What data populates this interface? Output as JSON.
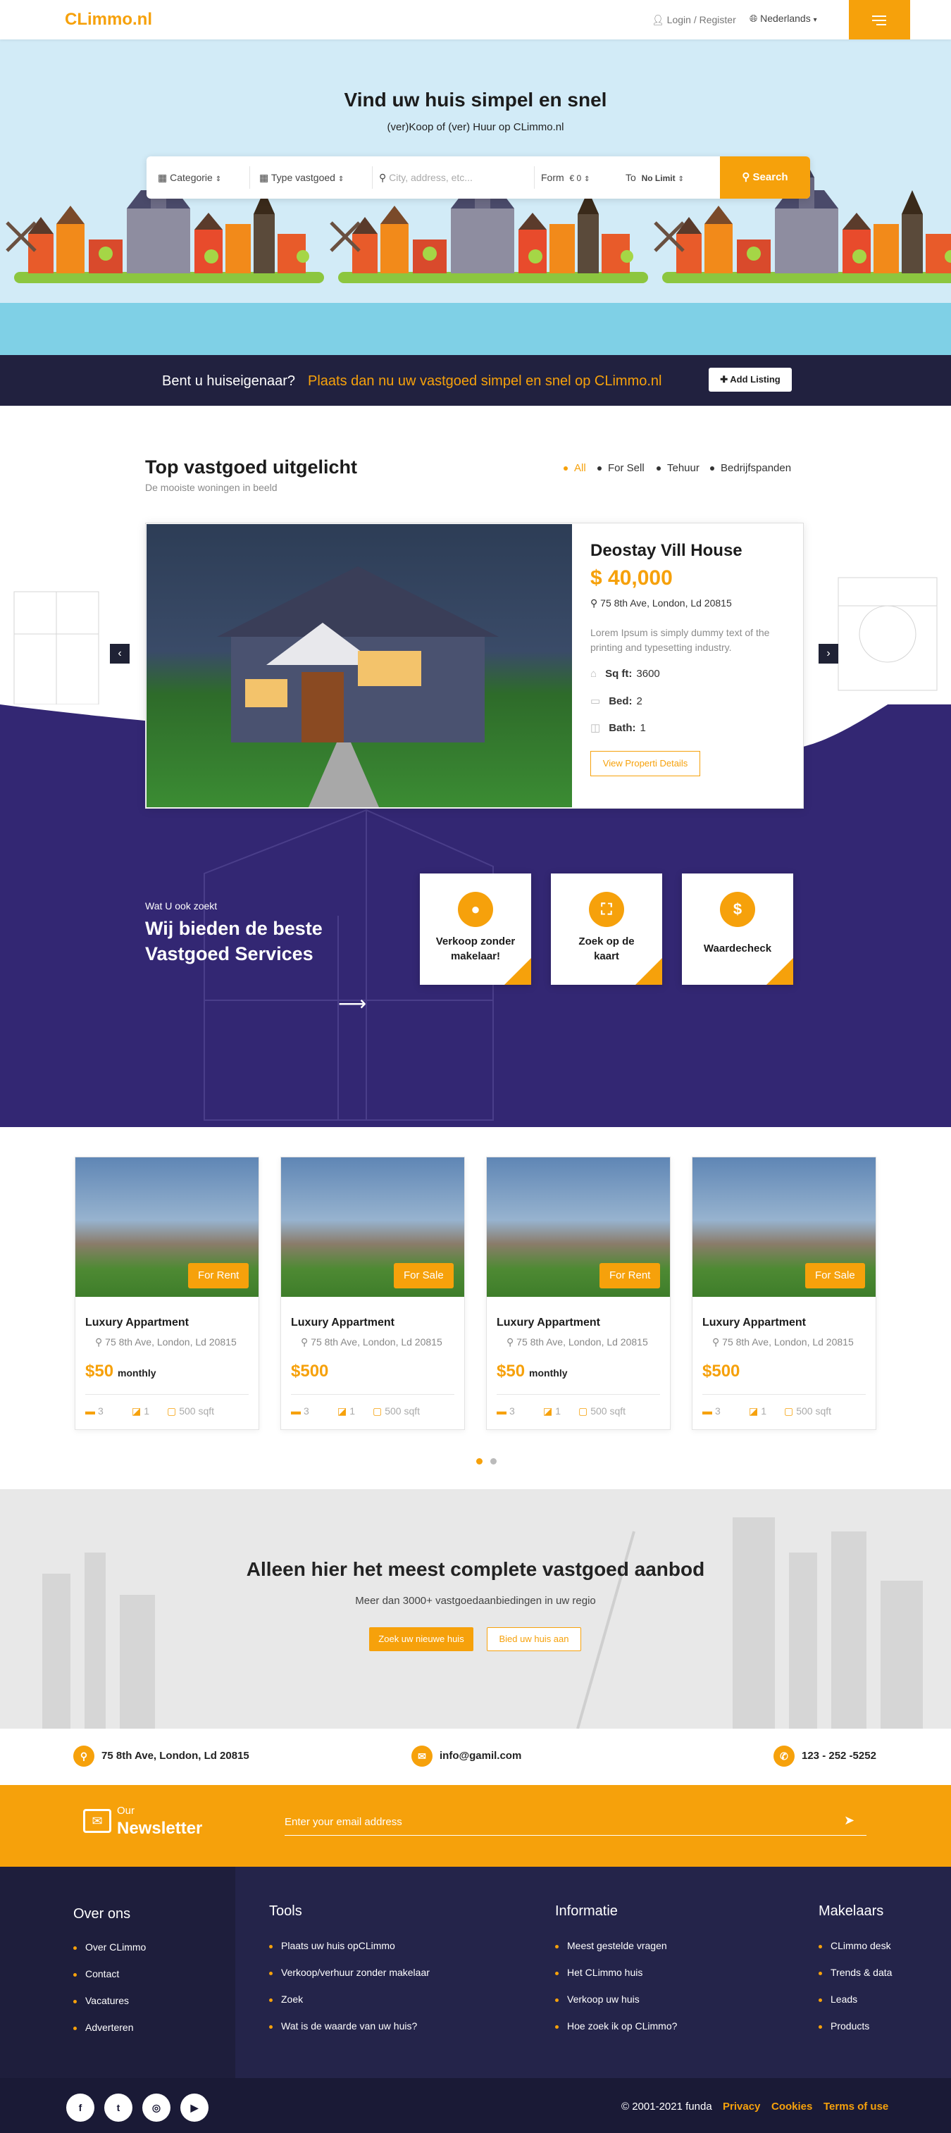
{
  "header": {
    "logo": "CLimmo.nl",
    "login": "Login / Register",
    "language": "Nederlands"
  },
  "hero": {
    "title": "Vind uw huis simpel en snel",
    "subtitle": "(ver)Koop of (ver) Huur op CLimmo.nl",
    "search": {
      "categorie": "Categorie",
      "type": "Type vastgoed",
      "location_placeholder": "City, address, etc...",
      "form_label": "Form",
      "form_value": "€ 0",
      "to_label": "To",
      "to_value": "No Limit",
      "button": "Search"
    }
  },
  "owner_banner": {
    "question": "Bent u huiseigenaar?",
    "cta": "Plaats dan nu uw vastgoed simpel en snel op CLimmo.nl",
    "button": "Add Listing"
  },
  "featured": {
    "title": "Top vastgoed uitgelicht",
    "subtitle": "De mooiste woningen in beeld",
    "filters": [
      "All",
      "For Sell",
      "Tehuur",
      "Bedrijfspanden"
    ],
    "property": {
      "name": "Deostay Vill House",
      "price": "$ 40,000",
      "address": "75 8th Ave, London, Ld 20815",
      "description": "Lorem Ipsum is simply dummy text of the printing and typesetting industry.",
      "sqft_label": "Sq ft:",
      "sqft": "3600",
      "bed_label": "Bed:",
      "bed": "2",
      "bath_label": "Bath:",
      "bath": "1",
      "button": "View Properti Details"
    }
  },
  "services": {
    "pretitle": "Wat U ook zoekt",
    "title": "Wij bieden de beste Vastgoed Services",
    "items": [
      {
        "label": "Verkoop zonder makelaar!",
        "icon": "user-icon"
      },
      {
        "label": "Zoek op de kaart",
        "icon": "map-icon"
      },
      {
        "label": "Waardecheck",
        "icon": "dollar-icon"
      }
    ]
  },
  "listings": [
    {
      "tag": "For Rent",
      "name": "Luxury Appartment",
      "address": "75 8th Ave, London, Ld 20815",
      "price": "$50",
      "period": "monthly",
      "beds": "3",
      "baths": "1",
      "area": "500 sqft"
    },
    {
      "tag": "For Sale",
      "name": "Luxury Appartment",
      "address": "75 8th Ave, London, Ld 20815",
      "price": "$500",
      "period": "",
      "beds": "3",
      "baths": "1",
      "area": "500 sqft"
    },
    {
      "tag": "For Rent",
      "name": "Luxury Appartment",
      "address": "75 8th Ave, London, Ld 20815",
      "price": "$50",
      "period": "monthly",
      "beds": "3",
      "baths": "1",
      "area": "500 sqft"
    },
    {
      "tag": "For Sale",
      "name": "Luxury Appartment",
      "address": "75 8th Ave, London, Ld 20815",
      "price": "$500",
      "period": "",
      "beds": "3",
      "baths": "1",
      "area": "500 sqft"
    }
  ],
  "cta": {
    "title": "Alleen hier het meest complete vastgoed aanbod",
    "subtitle": "Meer dan 3000+ vastgoedaanbiedingen in uw regio",
    "btn_primary": "Zoek uw nieuwe huis",
    "btn_secondary": "Bied uw huis aan"
  },
  "contact": {
    "address": "75 8th Ave, London, Ld 20815",
    "email": "info@gamil.com",
    "phone": "123 - 252 -5252"
  },
  "newsletter": {
    "our": "Our",
    "title": "Newsletter",
    "placeholder": "Enter your email address"
  },
  "footer": {
    "over": {
      "title": "Over ons",
      "links": [
        "Over CLimmo",
        "Contact",
        "Vacatures",
        "Adverteren"
      ]
    },
    "tools": {
      "title": "Tools",
      "links": [
        "Plaats uw huis opCLimmo",
        "Verkoop/verhuur zonder makelaar",
        "Zoek",
        "Wat is de waarde van uw huis?"
      ]
    },
    "info": {
      "title": "Informatie",
      "links": [
        "Meest gestelde vragen",
        "Het CLimmo huis",
        "Verkoop uw huis",
        "Hoe zoek ik op CLimmo?"
      ]
    },
    "makelaars": {
      "title": "Makelaars",
      "links": [
        "CLimmo desk",
        "Trends & data",
        "Leads",
        "Products"
      ]
    },
    "social": [
      "f",
      "t",
      "◎",
      "▶"
    ],
    "copyright": "© 2001-2021 funda",
    "privacy": "Privacy",
    "cookies": "Cookies",
    "terms": "Terms of use"
  },
  "colors": {
    "accent": "#f6a10b",
    "navy": "#21213f",
    "purple": "#332773"
  }
}
